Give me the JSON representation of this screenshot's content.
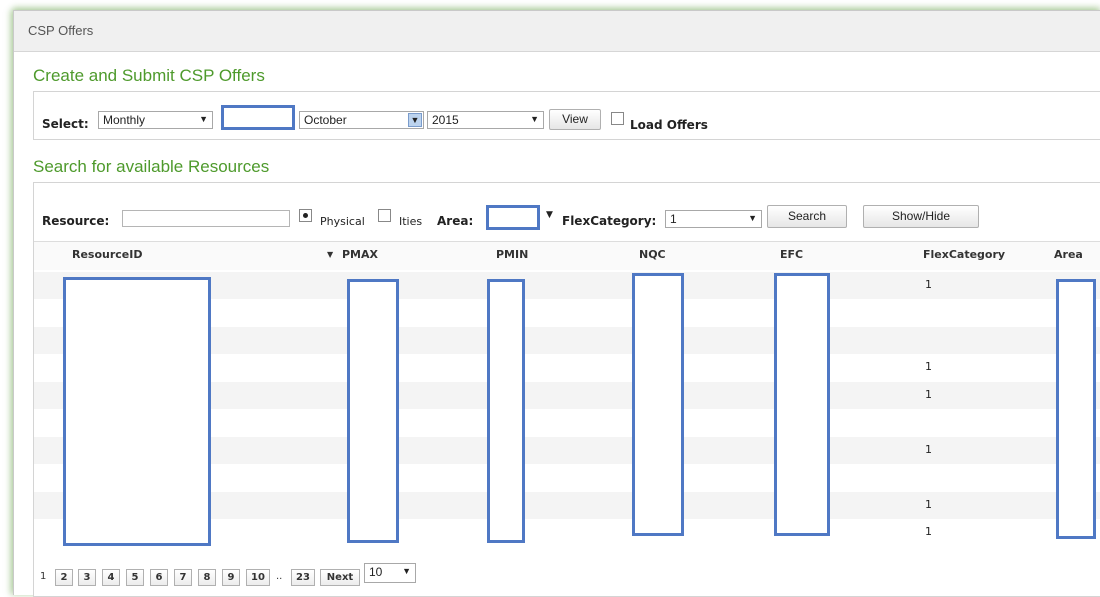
{
  "window": {
    "title": "CSP Offers"
  },
  "create_section": {
    "title": "Create and Submit CSP Offers",
    "select_label": "Select:",
    "period": "Monthly",
    "month": "October",
    "year": "2015",
    "view_label": "View",
    "load_offers_label": "Load Offers"
  },
  "search_section": {
    "title": "Search for available Resources",
    "resource_label": "Resource:",
    "physical_label": "Physical",
    "ities_label": "Ities",
    "area_label": "Area:",
    "flexcategory_label": "FlexCategory:",
    "flexcategory_value": "1",
    "search_label": "Search",
    "showhide_label": "Show/Hide"
  },
  "table": {
    "columns": [
      "ResourceID",
      "PMAX",
      "PMIN",
      "NQC",
      "EFC",
      "FlexCategory",
      "Area"
    ],
    "sort_icon": "sort-down-icon",
    "rows": [
      {
        "flex": "1"
      },
      {
        "flex": ""
      },
      {
        "flex": ""
      },
      {
        "flex": "1"
      },
      {
        "flex": "1"
      },
      {
        "flex": ""
      },
      {
        "flex": "1"
      },
      {
        "flex": ""
      },
      {
        "flex": "1"
      },
      {
        "flex": "1"
      }
    ]
  },
  "pagination": {
    "current": "1",
    "pages": [
      "2",
      "3",
      "4",
      "5",
      "6",
      "7",
      "8",
      "9",
      "10"
    ],
    "ellipsis": "..",
    "last": "23",
    "next_label": "Next",
    "page_size": "10"
  },
  "colors": {
    "accent_green": "#4e9a2c",
    "redaction_blue": "#4f78c4"
  }
}
